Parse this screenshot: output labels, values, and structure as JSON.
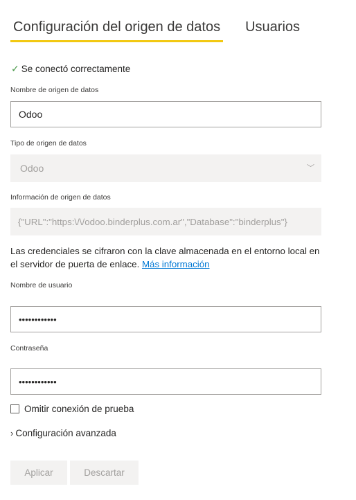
{
  "tabs": [
    {
      "label": "Configuración del origen de datos",
      "active": true
    },
    {
      "label": "Usuarios",
      "active": false
    }
  ],
  "status": {
    "icon": "checkmark-icon",
    "text": "Se conectó correctamente",
    "color": "#4a9a4a"
  },
  "datasource_name": {
    "label": "Nombre de origen de datos",
    "value": "Odoo"
  },
  "datasource_type": {
    "label": "Tipo de origen de datos",
    "value": "Odoo"
  },
  "datasource_info": {
    "label": "Información de origen de datos",
    "value": "{\"URL\":\"https:\\/\\/odoo.binderplus.com.ar\",\"Database\":\"binderplus\"}"
  },
  "credentials_note": {
    "text": "Las credenciales se cifraron con la clave almacenada en el entorno local en el servidor de puerta de enlace. ",
    "link": "Más información"
  },
  "username": {
    "label": "Nombre de usuario",
    "value": "••••••••••••"
  },
  "password": {
    "label": "Contraseña",
    "value": "••••••••••••"
  },
  "skip_test": {
    "label": "Omitir conexión de prueba",
    "checked": false
  },
  "advanced": {
    "label": "Configuración avanzada"
  },
  "buttons": {
    "apply": "Aplicar",
    "discard": "Descartar"
  },
  "colors": {
    "accent": "#f2c811",
    "link": "#0078d4",
    "disabled_bg": "#f3f2f1",
    "disabled_text": "#a19f9d"
  }
}
